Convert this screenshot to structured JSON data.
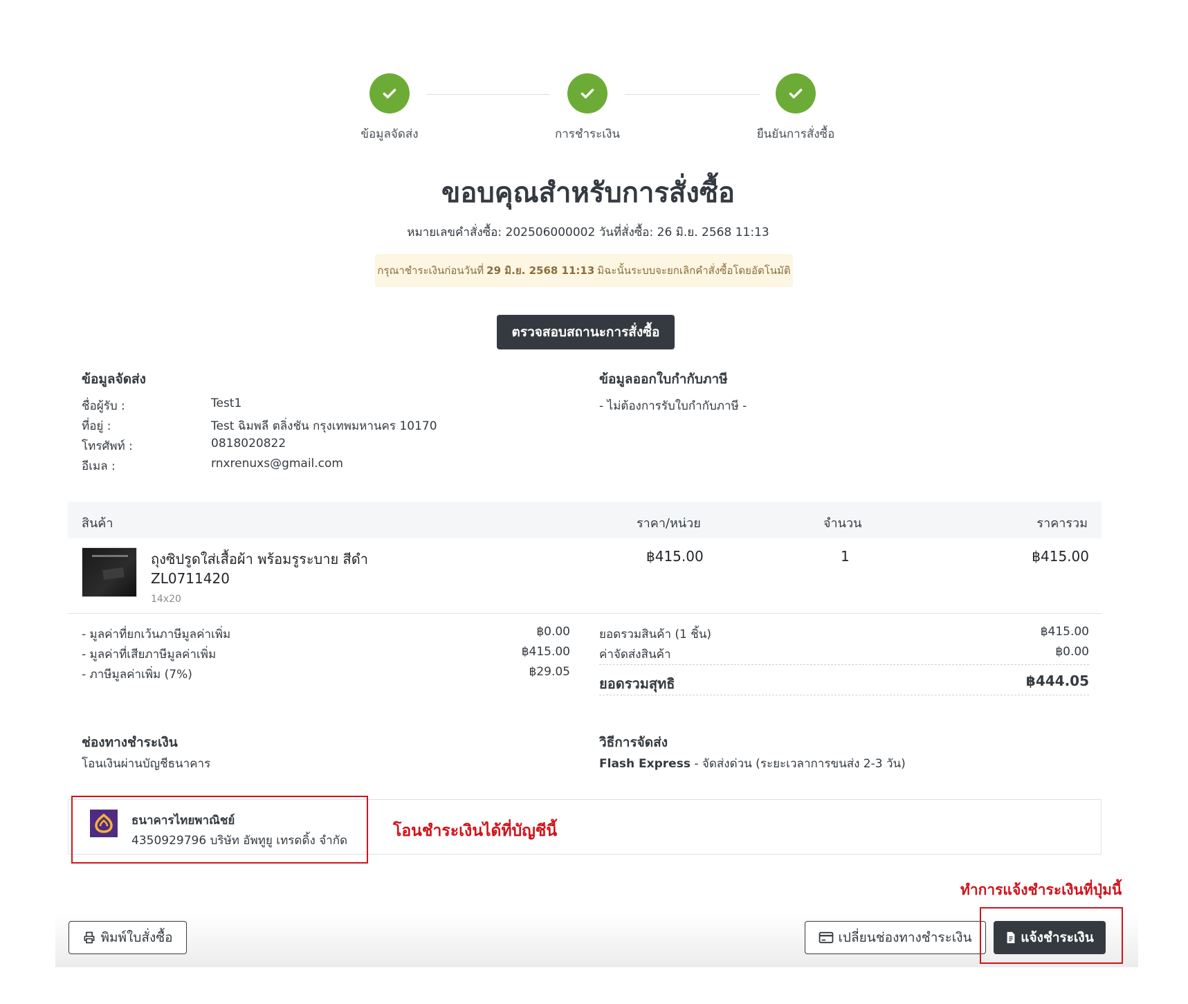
{
  "stepper": {
    "steps": [
      {
        "label": "ข้อมูลจัดส่ง"
      },
      {
        "label": "การชำระเงิน"
      },
      {
        "label": "ยืนยันการสั่งซื้อ"
      }
    ]
  },
  "header": {
    "title": "ขอบคุณสำหรับการสั่งซื้อ",
    "order_meta": "หมายเลขคำสั่งซื้อ: 202506000002 วันที่สั่งซื้อ: 26 มิ.ย. 2568 11:13"
  },
  "notice": {
    "before": "กรุณาชำระเงินก่อนวันที่",
    "deadline": "29 มิ.ย. 2568 11:13",
    "after": "มิฉะนั้นระบบจะยกเลิกคำสั่งซื้อโดยอัตโนมัติ"
  },
  "check_status_label": "ตรวจสอบสถานะการสั่งซื้อ",
  "shipping": {
    "heading": "ข้อมูลจัดส่ง",
    "rows": [
      {
        "label": "ชื่อผู้รับ :",
        "value": "Test1"
      },
      {
        "label": "ที่อยู่ :",
        "value": "Test ฉิมพลี ตลิ่งชัน กรุงเทพมหานคร 10170"
      },
      {
        "label": "โทรศัพท์ :",
        "value": "0818020822"
      },
      {
        "label": "อีเมล :",
        "value": "rnxrenuxs@gmail.com"
      }
    ]
  },
  "tax_invoice": {
    "heading": "ข้อมูลออกใบกำกับภาษี",
    "value": "- ไม่ต้องการรับใบกำกับภาษี -"
  },
  "table": {
    "headers": {
      "product": "สินค้า",
      "unit_price": "ราคา/หน่วย",
      "qty": "จำนวน",
      "total": "ราคารวม"
    },
    "items": [
      {
        "name": "ถุงซิปรูดใส่เสื้อผ้า พร้อมรูระบาย สีดำ",
        "sku": "ZL0711420",
        "variant": "14x20",
        "unit_price": "฿415.00",
        "qty": "1",
        "total": "฿415.00"
      }
    ]
  },
  "vat": [
    {
      "label": "- มูลค่าที่ยกเว้นภาษีมูลค่าเพิ่ม",
      "value": "฿0.00"
    },
    {
      "label": "- มูลค่าที่เสียภาษีมูลค่าเพิ่ม",
      "value": "฿415.00"
    },
    {
      "label": "- ภาษีมูลค่าเพิ่ม (7%)",
      "value": "฿29.05"
    }
  ],
  "summary": {
    "subtotal_label": "ยอดรวมสินค้า (1 ชิ้น)",
    "subtotal_value": "฿415.00",
    "shipping_label": "ค่าจัดส่งสินค้า",
    "shipping_value": "฿0.00",
    "net_label": "ยอดรวมสุทธิ",
    "net_value": "฿444.05"
  },
  "payment": {
    "heading": "ช่องทางชำระเงิน",
    "method": "โอนเงินผ่านบัญชีธนาคาร"
  },
  "delivery": {
    "heading": "วิธีการจัดส่ง",
    "carrier": "Flash Express",
    "detail": " - จัดส่งด่วน (ระยะเวลาการขนส่ง 2-3 วัน)"
  },
  "bank": {
    "name": "ธนาคารไทยพาณิชย์",
    "account": "4350929796 บริษัท อัพทูยู เทรดดิ้ง จำกัด"
  },
  "annotations": {
    "bank_note": "โอนชำระเงินได้ที่บัญชีนี้",
    "button_note": "ทำการแจ้งชำระเงินที่ปุ่มนี้"
  },
  "buttons": {
    "print": "พิมพ์ใบสั่งซื้อ",
    "change_payment": "เปลี่ยนช่องทางชำระเงิน",
    "notify_payment": "แจ้งชำระเงิน"
  },
  "colors": {
    "step_done": "#6cac36",
    "dark": "#343a40",
    "annotation_red": "#d0131a",
    "bank_purple": "#4f2c83",
    "notice_bg": "#fdf6e3"
  },
  "icons": [
    "check-icon",
    "printer-icon",
    "credit-card-icon",
    "document-icon",
    "bank-logo"
  ]
}
